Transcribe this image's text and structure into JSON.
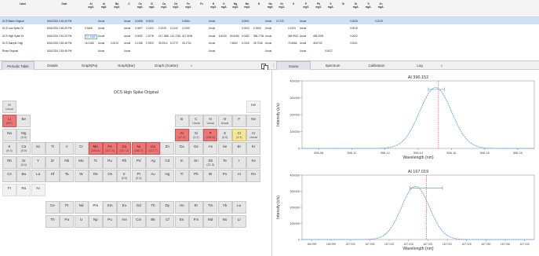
{
  "results": {
    "headers": [
      "Label",
      "Date",
      "Al\nmg/L",
      "Al\nmg/L",
      "Ba\nmg/L",
      "C",
      "Ca\nmg/L",
      "Cl\nmg/L",
      "Ca\nmg/L",
      "Cd\nmg/L",
      "Fe\nmg/L",
      "Fe",
      "H\nmg/L",
      "K\nmg/L",
      "Mg\nmg/L",
      "Mn\nmg/L",
      "N",
      "Na\nmg/L",
      "Ni\nmg/L",
      "O",
      "P\nmg/L",
      "Pb\nmg/L",
      "S\nmg/L",
      "Si",
      "Sr\nmg/L",
      "Ti\nmg/L",
      "Zn\nmg/L"
    ],
    "rows": [
      {
        "cells": [
          "DCS Blank Original",
          "8/16/2024 2:40:40 PM",
          "",
          "Uncal",
          "",
          "Uncal",
          "0.0496",
          "0.0002",
          "",
          "",
          "0.0054",
          "",
          "Uncal",
          "",
          "",
          "0.0001",
          "",
          "Uncal",
          "0.1723",
          "",
          "Uncal",
          "",
          "",
          "",
          "0.0026",
          "",
          "0.0219"
        ],
        "selected": true
      },
      {
        "cells": [
          "DCS Low Spike Or",
          "8/16/2024 2:50:30 PM",
          "0.3406",
          "Uncal",
          "",
          "Uncal",
          "0.0697",
          "2.0102",
          "0.2225",
          "0.1142",
          "2.0159",
          "",
          "Uncal",
          "",
          "",
          "0.0004",
          "0.1964",
          "Uncal",
          "",
          "0.1003",
          "Uncal",
          "",
          "",
          "",
          "0.0015",
          "",
          ""
        ],
        "selected": false
      },
      {
        "cells": [
          "DCS High Spike Or",
          "8/16/2024 2:51:33 PM",
          "17.1965",
          "Uncal",
          "",
          "Uncal",
          "0.0052",
          "1.9278",
          "417.1850",
          "113.7236",
          "417.3006",
          "",
          "Uncal",
          "8.4040",
          "50.6065",
          "0.0282",
          "384.7736",
          "Uncal",
          "",
          "384.9921",
          "Uncal",
          "455.0009",
          "",
          "",
          "0.0022",
          "",
          ""
        ],
        "selected": false
      },
      {
        "cells": [
          "DCS Sample Origi",
          "8/16/2024 2:52:46 PM",
          "16.3165",
          "Uncal",
          "0.0013",
          "Uncal",
          "0.1156",
          "2.7820",
          "39.2014",
          "5.3772",
          "33.1724",
          "",
          "Uncal",
          "",
          "7.6642",
          "0.0118",
          "28.7248",
          "Uncal",
          "",
          "74.5666",
          "Uncal",
          "45.6742",
          "",
          "",
          "0.0031",
          "",
          ""
        ],
        "selected": false
      },
      {
        "cells": [
          "Rinse Original",
          "8/16/2024 2:53:48 PM",
          "",
          "Uncal",
          "",
          "Uncal",
          "",
          "",
          "",
          "",
          "",
          "",
          "Uncal",
          "",
          "",
          "",
          "",
          "Uncal",
          "",
          "",
          "Uncal",
          "",
          "0.0027",
          "",
          "",
          "",
          ""
        ],
        "selected": false
      }
    ]
  },
  "left_tabs": [
    "Periodic Table",
    "Details",
    "Graph(Pa)",
    "Graph(Bar)",
    "Graph (Scatter)"
  ],
  "left_tab_extra": "x",
  "right_tabs": [
    "Scans",
    "Spectrum",
    "Calibration",
    "Log"
  ],
  "right_tab_extra": "x",
  "periodic_table": {
    "title": "DCS High Spike Original",
    "elements": [
      {
        "s": "H",
        "v": "Uncal",
        "c": "gray",
        "r": 0,
        "col": 0
      },
      {
        "s": "He",
        "v": "",
        "c": "blank",
        "r": 0,
        "col": 17
      },
      {
        "s": "Li",
        "v": "(587)",
        "c": "red",
        "r": 1,
        "col": 0
      },
      {
        "s": "Be",
        "v": "",
        "c": "gray",
        "r": 1,
        "col": 1
      },
      {
        "s": "B",
        "v": "",
        "c": "gray",
        "r": 1,
        "col": 12
      },
      {
        "s": "C",
        "v": "Uncal",
        "c": "gray",
        "r": 1,
        "col": 13
      },
      {
        "s": "N",
        "v": "Uncal",
        "c": "gray",
        "r": 1,
        "col": 14
      },
      {
        "s": "O",
        "v": "Uncal",
        "c": "gray",
        "r": 1,
        "col": 15
      },
      {
        "s": "F",
        "v": "",
        "c": "gray",
        "r": 1,
        "col": 16
      },
      {
        "s": "Ne",
        "v": "",
        "c": "gray",
        "r": 1,
        "col": 17
      },
      {
        "s": "Na",
        "v": "",
        "c": "gray",
        "r": 2,
        "col": 0
      },
      {
        "s": "Mg",
        "v": "(0.0)",
        "c": "gray",
        "r": 2,
        "col": 1
      },
      {
        "s": "Al",
        "v": "(17.2)",
        "c": "red",
        "r": 2,
        "col": 12
      },
      {
        "s": "Si",
        "v": "(0.2)",
        "c": "gray",
        "r": 2,
        "col": 13
      },
      {
        "s": "P",
        "v": "(455.0)",
        "c": "red",
        "r": 2,
        "col": 14
      },
      {
        "s": "S",
        "v": "(0.0)",
        "c": "gray",
        "r": 2,
        "col": 15
      },
      {
        "s": "Cl",
        "v": "(1.9)",
        "c": "yellow",
        "r": 2,
        "col": 16
      },
      {
        "s": "Ar",
        "v": "Uncal",
        "c": "gray",
        "r": 2,
        "col": 17
      },
      {
        "s": "K",
        "v": "(8.4)",
        "c": "gray",
        "r": 3,
        "col": 0
      },
      {
        "s": "Ca",
        "v": "(0.0)",
        "c": "gray",
        "r": 3,
        "col": 1
      },
      {
        "s": "Sc",
        "v": "",
        "c": "gray",
        "r": 3,
        "col": 2
      },
      {
        "s": "Ti",
        "v": "",
        "c": "gray",
        "r": 3,
        "col": 3
      },
      {
        "s": "V",
        "v": "",
        "c": "gray",
        "r": 3,
        "col": 4
      },
      {
        "s": "Cr",
        "v": "",
        "c": "gray",
        "r": 3,
        "col": 5
      },
      {
        "s": "Mn",
        "v": "(384.8)",
        "c": "red",
        "r": 3,
        "col": 6
      },
      {
        "s": "Fe",
        "v": "(417.4)",
        "c": "red",
        "r": 3,
        "col": 7
      },
      {
        "s": "Co",
        "v": "(417.2)",
        "c": "red",
        "r": 3,
        "col": 8
      },
      {
        "s": "Ni",
        "v": "(385.0)",
        "c": "red",
        "r": 3,
        "col": 9
      },
      {
        "s": "Cu",
        "v": "(113.7)",
        "c": "red",
        "r": 3,
        "col": 10
      },
      {
        "s": "Zn",
        "v": "",
        "c": "gray",
        "r": 3,
        "col": 11
      },
      {
        "s": "Ga",
        "v": "",
        "c": "gray",
        "r": 3,
        "col": 12
      },
      {
        "s": "Ge",
        "v": "",
        "c": "gray",
        "r": 3,
        "col": 13
      },
      {
        "s": "As",
        "v": "",
        "c": "gray",
        "r": 3,
        "col": 14
      },
      {
        "s": "Se",
        "v": "",
        "c": "gray",
        "r": 3,
        "col": 15
      },
      {
        "s": "Br",
        "v": "",
        "c": "gray",
        "r": 3,
        "col": 16
      },
      {
        "s": "Kr",
        "v": "",
        "c": "gray",
        "r": 3,
        "col": 17
      },
      {
        "s": "Rb",
        "v": "",
        "c": "gray",
        "r": 4,
        "col": 0
      },
      {
        "s": "Sr",
        "v": "(0.0)",
        "c": "gray",
        "r": 4,
        "col": 1
      },
      {
        "s": "Y",
        "v": "",
        "c": "gray",
        "r": 4,
        "col": 2
      },
      {
        "s": "Zr",
        "v": "",
        "c": "gray",
        "r": 4,
        "col": 3
      },
      {
        "s": "Nb",
        "v": "",
        "c": "gray",
        "r": 4,
        "col": 4
      },
      {
        "s": "Mo",
        "v": "",
        "c": "gray",
        "r": 4,
        "col": 5
      },
      {
        "s": "Tc",
        "v": "",
        "c": "gray",
        "r": 4,
        "col": 6
      },
      {
        "s": "Ru",
        "v": "",
        "c": "gray",
        "r": 4,
        "col": 7
      },
      {
        "s": "Rh",
        "v": "",
        "c": "gray",
        "r": 4,
        "col": 8
      },
      {
        "s": "Pd",
        "v": "",
        "c": "gray",
        "r": 4,
        "col": 9
      },
      {
        "s": "Ag",
        "v": "",
        "c": "gray",
        "r": 4,
        "col": 10
      },
      {
        "s": "Cd",
        "v": "",
        "c": "gray",
        "r": 4,
        "col": 11
      },
      {
        "s": "In",
        "v": "",
        "c": "gray",
        "r": 4,
        "col": 12
      },
      {
        "s": "Sn",
        "v": "",
        "c": "gray",
        "r": 4,
        "col": 13
      },
      {
        "s": "Sb",
        "v": "(21.3)",
        "c": "gray",
        "r": 4,
        "col": 14
      },
      {
        "s": "Te",
        "v": "",
        "c": "gray",
        "r": 4,
        "col": 15
      },
      {
        "s": "I",
        "v": "",
        "c": "gray",
        "r": 4,
        "col": 16
      },
      {
        "s": "Xe",
        "v": "",
        "c": "gray",
        "r": 4,
        "col": 17
      },
      {
        "s": "Cs",
        "v": "",
        "c": "gray",
        "r": 5,
        "col": 0
      },
      {
        "s": "Ba",
        "v": "",
        "c": "gray",
        "r": 5,
        "col": 1
      },
      {
        "s": "La",
        "v": "",
        "c": "gray",
        "r": 5,
        "col": 2
      },
      {
        "s": "Hf",
        "v": "",
        "c": "gray",
        "r": 5,
        "col": 3
      },
      {
        "s": "Ta",
        "v": "",
        "c": "gray",
        "r": 5,
        "col": 4
      },
      {
        "s": "W",
        "v": "",
        "c": "gray",
        "r": 5,
        "col": 5
      },
      {
        "s": "Re",
        "v": "",
        "c": "gray",
        "r": 5,
        "col": 6
      },
      {
        "s": "Os",
        "v": "",
        "c": "gray",
        "r": 5,
        "col": 7
      },
      {
        "s": "Ir",
        "v": "(0.0)",
        "c": "gray",
        "r": 5,
        "col": 8
      },
      {
        "s": "Pt",
        "v": "(0.0)",
        "c": "gray",
        "r": 5,
        "col": 9
      },
      {
        "s": "Au",
        "v": "",
        "c": "gray",
        "r": 5,
        "col": 10
      },
      {
        "s": "Hg",
        "v": "",
        "c": "gray",
        "r": 5,
        "col": 11
      },
      {
        "s": "Tl",
        "v": "",
        "c": "gray",
        "r": 5,
        "col": 12
      },
      {
        "s": "Pb",
        "v": "",
        "c": "gray",
        "r": 5,
        "col": 13
      },
      {
        "s": "Bi",
        "v": "",
        "c": "gray",
        "r": 5,
        "col": 14
      },
      {
        "s": "Po",
        "v": "",
        "c": "gray",
        "r": 5,
        "col": 15
      },
      {
        "s": "At",
        "v": "",
        "c": "gray",
        "r": 5,
        "col": 16
      },
      {
        "s": "Rn",
        "v": "",
        "c": "gray",
        "r": 5,
        "col": 17
      },
      {
        "s": "Fr",
        "v": "",
        "c": "blank",
        "r": 6,
        "col": 0
      },
      {
        "s": "Ra",
        "v": "",
        "c": "blank",
        "r": 6,
        "col": 1
      },
      {
        "s": "Ac",
        "v": "",
        "c": "blank",
        "r": 6,
        "col": 2
      },
      {
        "s": "Ce",
        "v": "",
        "c": "gray",
        "r": 7,
        "col": 3
      },
      {
        "s": "Pr",
        "v": "",
        "c": "gray",
        "r": 7,
        "col": 4
      },
      {
        "s": "Nd",
        "v": "",
        "c": "gray",
        "r": 7,
        "col": 5
      },
      {
        "s": "Pm",
        "v": "",
        "c": "blank",
        "r": 7,
        "col": 6
      },
      {
        "s": "Sm",
        "v": "",
        "c": "gray",
        "r": 7,
        "col": 7
      },
      {
        "s": "Eu",
        "v": "",
        "c": "gray",
        "r": 7,
        "col": 8
      },
      {
        "s": "Gd",
        "v": "",
        "c": "gray",
        "r": 7,
        "col": 9
      },
      {
        "s": "Tb",
        "v": "",
        "c": "gray",
        "r": 7,
        "col": 10
      },
      {
        "s": "Dy",
        "v": "",
        "c": "gray",
        "r": 7,
        "col": 11
      },
      {
        "s": "Ho",
        "v": "",
        "c": "gray",
        "r": 7,
        "col": 12
      },
      {
        "s": "Er",
        "v": "",
        "c": "gray",
        "r": 7,
        "col": 13
      },
      {
        "s": "Tm",
        "v": "",
        "c": "gray",
        "r": 7,
        "col": 14
      },
      {
        "s": "Yb",
        "v": "",
        "c": "gray",
        "r": 7,
        "col": 15
      },
      {
        "s": "Lu",
        "v": "",
        "c": "gray",
        "r": 7,
        "col": 16
      },
      {
        "s": "Th",
        "v": "",
        "c": "gray",
        "r": 8,
        "col": 3
      },
      {
        "s": "Pa",
        "v": "",
        "c": "gray",
        "r": 8,
        "col": 4
      },
      {
        "s": "U",
        "v": "",
        "c": "gray",
        "r": 8,
        "col": 5
      },
      {
        "s": "Np",
        "v": "",
        "c": "gray",
        "r": 8,
        "col": 6
      },
      {
        "s": "Pu",
        "v": "",
        "c": "gray",
        "r": 8,
        "col": 7
      },
      {
        "s": "Am",
        "v": "",
        "c": "gray",
        "r": 8,
        "col": 8
      },
      {
        "s": "Cm",
        "v": "",
        "c": "gray",
        "r": 8,
        "col": 9
      },
      {
        "s": "Bk",
        "v": "",
        "c": "gray",
        "r": 8,
        "col": 10
      },
      {
        "s": "Cf",
        "v": "",
        "c": "gray",
        "r": 8,
        "col": 11
      },
      {
        "s": "Es",
        "v": "",
        "c": "gray",
        "r": 8,
        "col": 12
      },
      {
        "s": "Fm",
        "v": "",
        "c": "gray",
        "r": 8,
        "col": 13
      },
      {
        "s": "Md",
        "v": "",
        "c": "gray",
        "r": 8,
        "col": 14
      },
      {
        "s": "No",
        "v": "",
        "c": "gray",
        "r": 8,
        "col": 15
      },
      {
        "s": "Lr",
        "v": "",
        "c": "gray",
        "r": 8,
        "col": 16
      }
    ]
  },
  "chart_data": [
    {
      "type": "line",
      "title": "Al 396.152",
      "xlabel": "Wavelength (nm)",
      "ylabel": "Intensity (c/s)",
      "xlim": [
        396.06,
        396.22
      ],
      "ylim": [
        0,
        400000
      ],
      "xticks": [
        "396.08",
        "396.10",
        "396.12",
        "396.14",
        "396.16",
        "396.18",
        "396.20"
      ],
      "yticks": [
        "0",
        "100000",
        "200000",
        "300000",
        "400000"
      ],
      "peak_center": 396.152,
      "peak_height": 360000,
      "peak_sigma": 0.011,
      "marker_line": 396.154,
      "window": [
        396.147,
        396.158
      ],
      "grid": false,
      "color": "#6b9fdc",
      "marker_color": "#e04040"
    },
    {
      "type": "line",
      "title": "Al 167.019",
      "xlabel": "Wavelength (nm)",
      "ylabel": "Intensity (c/s)",
      "xlim": [
        166.998,
        167.041
      ],
      "ylim": [
        0,
        400000
      ],
      "xticks": [
        "166.999",
        "166.999",
        "167.000",
        "167.006",
        "167.010",
        "167.016",
        "167.020",
        "167.022",
        "167.026",
        "167.030",
        "167.036",
        "167.040"
      ],
      "yticks": [
        "0",
        "100000",
        "200000",
        "300000",
        "400000"
      ],
      "peak_center": 167.019,
      "peak_height": 330000,
      "peak_sigma": 0.0026,
      "marker_line": 167.021,
      "window": [
        167.018,
        167.024
      ],
      "grid": false,
      "color": "#6b9fdc",
      "marker_color": "#e04040"
    }
  ]
}
